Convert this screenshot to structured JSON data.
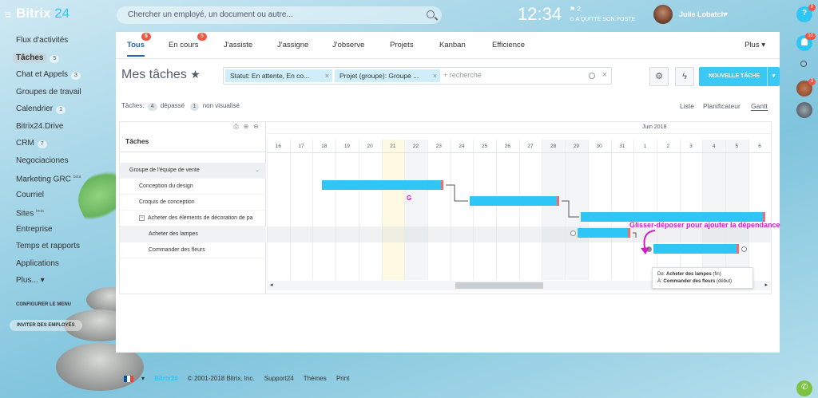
{
  "brand": {
    "name": "Bitrix",
    "num": "24"
  },
  "search": {
    "placeholder": "Chercher un employé, un document ou autre..."
  },
  "header": {
    "time": "12:34",
    "flag_count": "2",
    "status": "A QUITTÉ SON POSTE",
    "username": "Julie Lobatch"
  },
  "sidebar": {
    "items": [
      {
        "label": "Flux d'activités"
      },
      {
        "label": "Tâches",
        "badge": "5"
      },
      {
        "label": "Chat et Appels",
        "badge": "3"
      },
      {
        "label": "Groupes de travail"
      },
      {
        "label": "Calendrier",
        "badge": "1"
      },
      {
        "label": "Bitrix24.Drive"
      },
      {
        "label": "CRM",
        "badge": "7"
      },
      {
        "label": "Negociaciones"
      },
      {
        "label": "Marketing GRC",
        "sup": "beta"
      },
      {
        "label": "Courriel"
      },
      {
        "label": "Sites",
        "sup": "beta"
      },
      {
        "label": "Entreprise"
      },
      {
        "label": "Temps et rapports"
      },
      {
        "label": "Applications"
      },
      {
        "label": "Plus..."
      }
    ],
    "configure": "CONFIGURER LE MENU",
    "invite": "INVITER DES EMPLOYÉS"
  },
  "rail": {
    "notif_badge": "8",
    "bell_badge": "10",
    "avatar_badge": "3"
  },
  "tabs": [
    {
      "label": "Tous",
      "badge": "5"
    },
    {
      "label": "En cours",
      "badge": "5"
    },
    {
      "label": "J'assiste"
    },
    {
      "label": "J'assigne"
    },
    {
      "label": "J'observe"
    },
    {
      "label": "Projets"
    },
    {
      "label": "Kanban"
    },
    {
      "label": "Efficience"
    }
  ],
  "tabs_more": "Plus",
  "page": {
    "title": "Mes tâches"
  },
  "filter": {
    "chips": [
      "Statut: En attente, En co...",
      "Projet (groupe): Groupe ..."
    ],
    "placeholder": "+ recherche"
  },
  "new_task": "NOUVELLE TÂCHE",
  "counters": {
    "label": "Tâches:",
    "overdue_count": "4",
    "overdue": "dépassé",
    "unseen_count": "1",
    "unseen": "non visualisé"
  },
  "views": [
    "Liste",
    "Planificateur",
    "Gantt"
  ],
  "gantt": {
    "header": "Tâches",
    "month": "Juin 2018",
    "days": [
      "16",
      "17",
      "18",
      "19",
      "20",
      "21",
      "22",
      "23",
      "24",
      "25",
      "26",
      "27",
      "28",
      "29",
      "30",
      "31",
      "1",
      "2",
      "3",
      "4",
      "5",
      "6"
    ],
    "rows": [
      {
        "label": "Groupe de l'équipe de vente"
      },
      {
        "label": "Conception du design"
      },
      {
        "label": "Croquis de conception"
      },
      {
        "label": "Acheter des éléments de décoration de pa"
      },
      {
        "label": "Acheter des lampes"
      },
      {
        "label": "Commander des fleurs"
      }
    ],
    "annot_g": "G",
    "annotation": "Glisser-déposer pour ajouter la dépendance",
    "tooltip": {
      "from_label": "De:",
      "from": "Acheter des lampes",
      "from_suffix": "(fin)",
      "to_label": "À:",
      "to": "Commander des fleurs",
      "to_suffix": "(début)"
    }
  },
  "footer": {
    "lang": "",
    "brand": "Bitrix24",
    "copyright": "© 2001-2018 Bitrix, Inc.",
    "support": "Support24",
    "themes": "Thèmes",
    "print": "Print"
  }
}
